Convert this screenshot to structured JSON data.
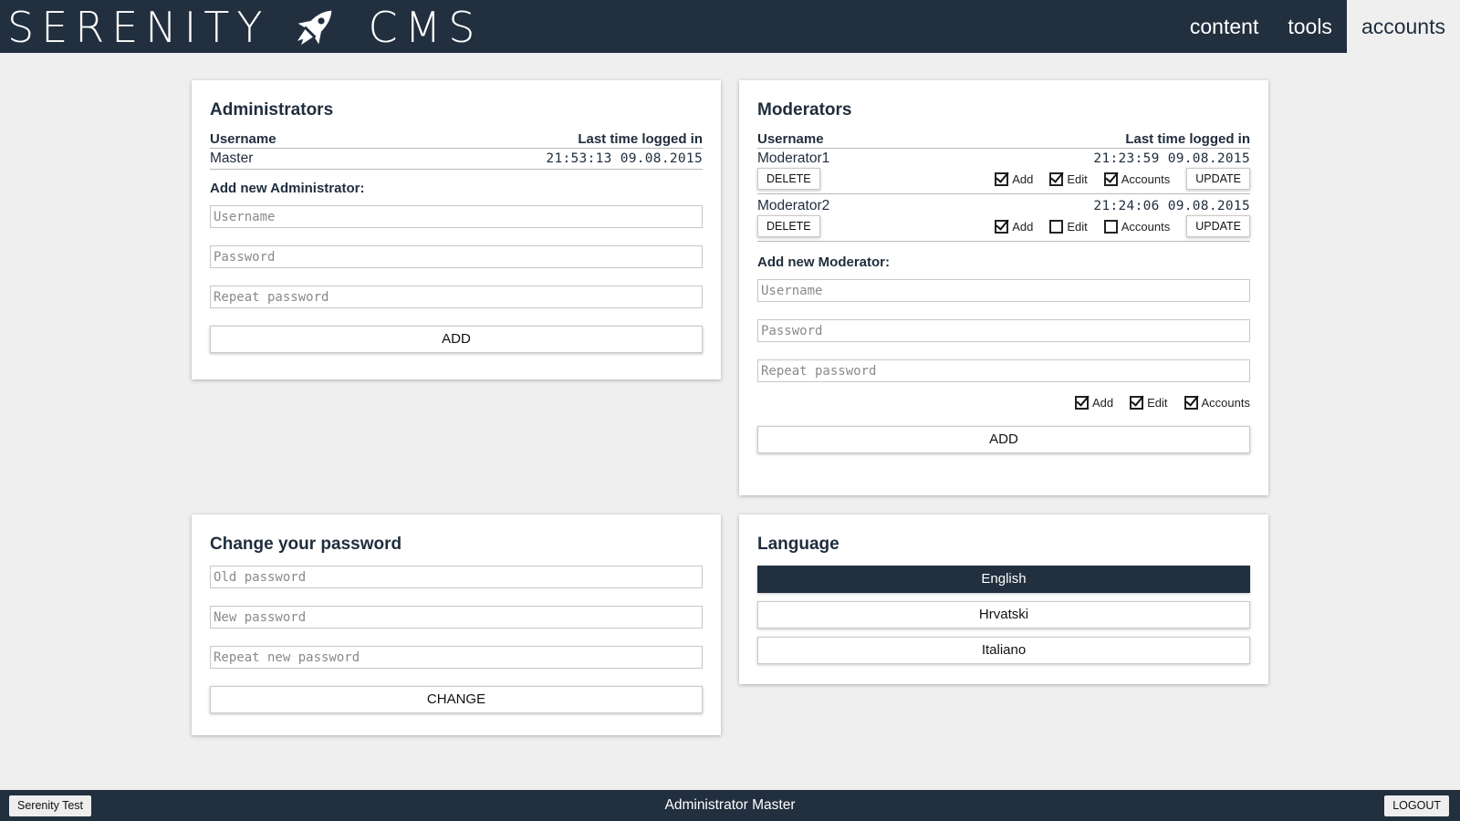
{
  "header": {
    "logo_left": "SERENITY",
    "logo_right": "CMS",
    "logo_icon": "rocket-icon",
    "nav": [
      {
        "label": "content",
        "active": false
      },
      {
        "label": "tools",
        "active": false
      },
      {
        "label": "accounts",
        "active": true
      }
    ]
  },
  "administrators": {
    "title": "Administrators",
    "col_username": "Username",
    "col_last_login": "Last time logged in",
    "rows": [
      {
        "username": "Master",
        "last_login": "21:53:13 09.08.2015"
      }
    ],
    "add_title": "Add new Administrator:",
    "username_placeholder": "Username",
    "password_placeholder": "Password",
    "repeat_placeholder": "Repeat password",
    "add_label": "ADD"
  },
  "moderators": {
    "title": "Moderators",
    "col_username": "Username",
    "col_last_login": "Last time logged in",
    "delete_label": "DELETE",
    "update_label": "UPDATE",
    "perm_add": "Add",
    "perm_edit": "Edit",
    "perm_accounts": "Accounts",
    "rows": [
      {
        "username": "Moderator1",
        "last_login": "21:23:59 09.08.2015",
        "add": true,
        "edit": true,
        "accounts": true
      },
      {
        "username": "Moderator2",
        "last_login": "21:24:06 09.08.2015",
        "add": true,
        "edit": false,
        "accounts": false
      }
    ],
    "add_title": "Add new Moderator:",
    "username_placeholder": "Username",
    "password_placeholder": "Password",
    "repeat_placeholder": "Repeat password",
    "new_perms": {
      "add": true,
      "edit": true,
      "accounts": true
    },
    "add_label": "ADD"
  },
  "change_password": {
    "title": "Change your password",
    "old_placeholder": "Old password",
    "new_placeholder": "New password",
    "repeat_placeholder": "Repeat new password",
    "change_label": "CHANGE"
  },
  "language": {
    "title": "Language",
    "options": [
      {
        "label": "English",
        "active": true
      },
      {
        "label": "Hrvatski",
        "active": false
      },
      {
        "label": "Italiano",
        "active": false
      }
    ]
  },
  "footer": {
    "site_button": "Serenity Test",
    "user_text": "Administrator Master",
    "logout_label": "LOGOUT"
  },
  "colors": {
    "navbar": "#222f3f",
    "background": "#efefef",
    "panel": "#ffffff"
  }
}
